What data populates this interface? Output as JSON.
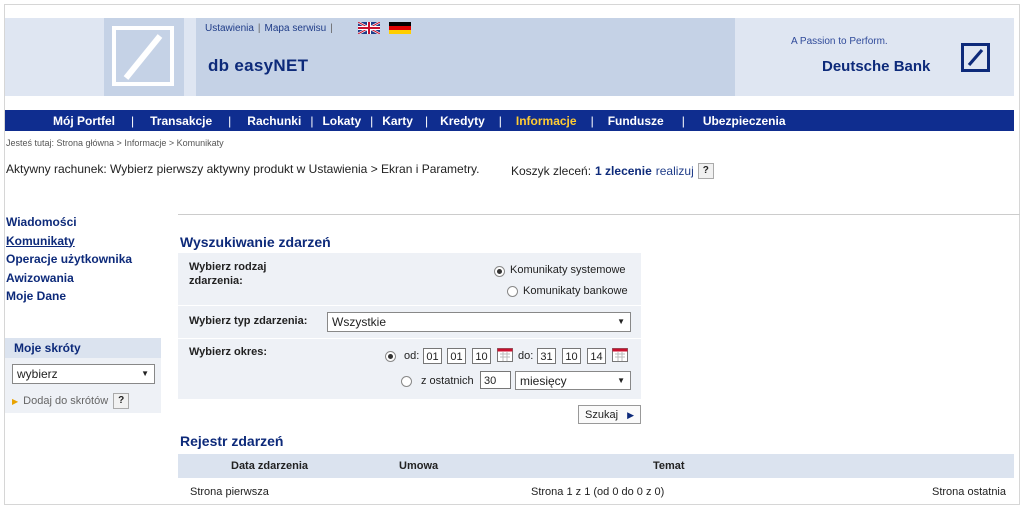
{
  "header": {
    "links": [
      "Ustawienia",
      "Mapa serwisu"
    ],
    "flags": [
      "uk-flag-icon",
      "de-flag-icon"
    ],
    "product": "db easyNET",
    "tagline": "A Passion to Perform.",
    "bank": "Deutsche Bank"
  },
  "nav": {
    "items": [
      "Mój Portfel",
      "Transakcje",
      "Rachunki",
      "Lokaty",
      "Karty",
      "Kredyty",
      "Informacje",
      "Fundusze",
      "Ubezpieczenia"
    ],
    "active": "Informacje",
    "active_color": "#ffcc33",
    "bar_color": "#0f2d8f"
  },
  "breadcrumb": "Jesteś tutaj:  Strona główna  >  Informacje  >  Komunikaty",
  "account": {
    "text": "Aktywny rachunek:  Wybierz pierwszy aktywny produkt w Ustawienia > Ekran i Parametry."
  },
  "basket": {
    "label": "Koszyk zleceń:",
    "count": "1 zlecenie",
    "action": "realizuj",
    "help": "?"
  },
  "sidebar": {
    "items": [
      "Wiadomości",
      "Komunikaty",
      "Operacje użytkownika",
      "Awizowania",
      "Moje Dane"
    ],
    "current": "Komunikaty"
  },
  "shortcuts": {
    "title": "Moje skróty",
    "select_value": "wybierz",
    "add_label": "Dodaj do skrótów",
    "help": "?"
  },
  "search": {
    "title": "Wyszukiwanie zdarzeń",
    "kind_label_1": "Wybierz rodzaj",
    "kind_label_2": "zdarzenia:",
    "kind_options": [
      "Komunikaty systemowe",
      "Komunikaty bankowe"
    ],
    "kind_selected": "Komunikaty systemowe",
    "type_label": "Wybierz typ zdarzenia:",
    "type_value": "Wszystkie",
    "period_label": "Wybierz okres:",
    "from_label": "od:",
    "from": [
      "01",
      "01",
      "10"
    ],
    "to_label": "do:",
    "to": [
      "31",
      "10",
      "14"
    ],
    "last_label": "z ostatnich",
    "last_value": "30",
    "last_unit": "miesięcy",
    "submit": "Szukaj"
  },
  "register": {
    "title": "Rejestr zdarzeń",
    "columns": [
      "Data zdarzenia",
      "Umowa",
      "Temat"
    ],
    "first": "Strona pierwsza",
    "page_info": "Strona 1 z 1 (od 0 do 0 z 0)",
    "last": "Strona ostatnia"
  }
}
